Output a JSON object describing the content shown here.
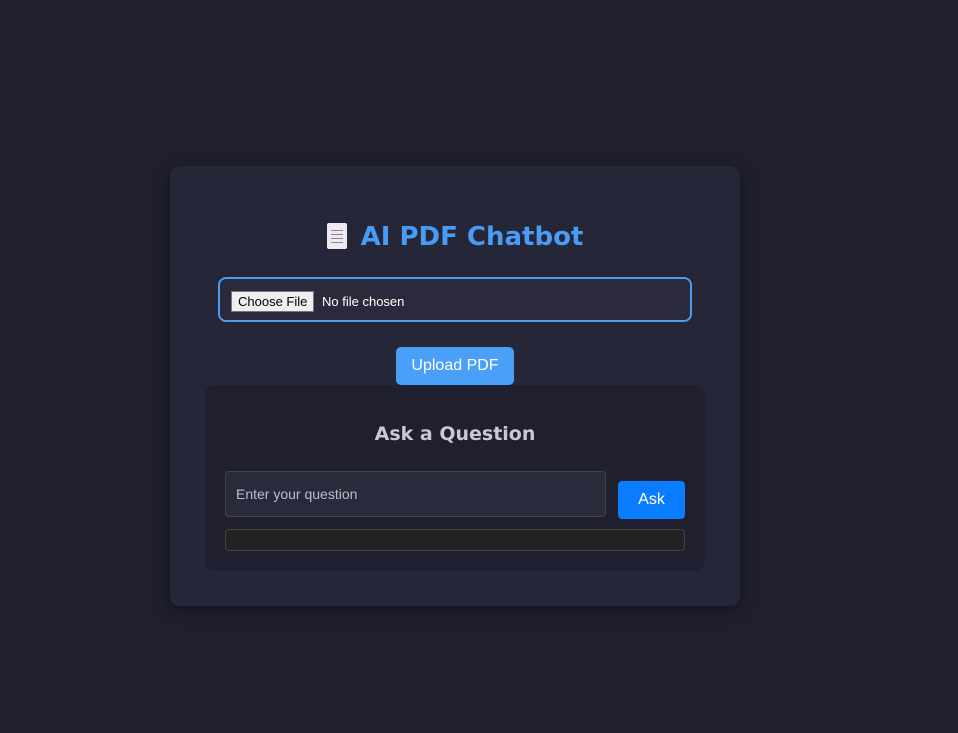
{
  "header": {
    "title": "AI PDF Chatbot",
    "icon": "document-icon"
  },
  "upload": {
    "choose_label": "Choose File",
    "file_status": "No file chosen",
    "button_label": "Upload PDF"
  },
  "ask": {
    "title": "Ask a Question",
    "placeholder": "Enter your question",
    "value": "",
    "button_label": "Ask",
    "response": ""
  },
  "colors": {
    "accent": "#4a9bf5",
    "ask_button": "#0a7cff",
    "background": "#1f1f2e"
  }
}
